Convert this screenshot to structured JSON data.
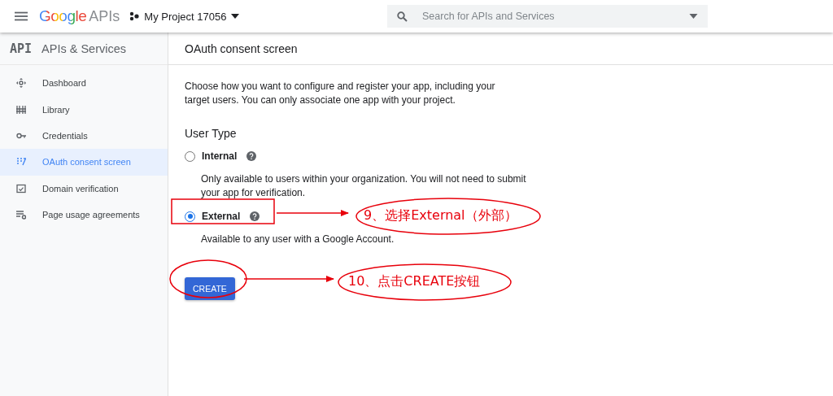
{
  "header": {
    "logo_brand": "Google",
    "logo_product": "APIs",
    "project": "My Project 17056",
    "search": {
      "placeholder": "Search for APIs and Services"
    }
  },
  "sidebar": {
    "badge": "API",
    "title": "APIs & Services",
    "items": [
      {
        "label": "Dashboard",
        "selected": false
      },
      {
        "label": "Library",
        "selected": false
      },
      {
        "label": "Credentials",
        "selected": false
      },
      {
        "label": "OAuth consent screen",
        "selected": true
      },
      {
        "label": "Domain verification",
        "selected": false
      },
      {
        "label": "Page usage agreements",
        "selected": false
      }
    ]
  },
  "main": {
    "title": "OAuth consent screen",
    "intro": "Choose how you want to configure and register your app, including your target users. You can only associate one app with your project.",
    "section": "User Type",
    "options": [
      {
        "label": "Internal",
        "selected": false,
        "description": "Only available to users within your organization. You will not need to submit your app for verification."
      },
      {
        "label": "External",
        "selected": true,
        "description": "Available to any user with a Google Account."
      }
    ],
    "button": "CREATE"
  },
  "annotations": [
    "9、选择External（外部）",
    "10、点击CREATE按钮"
  ]
}
